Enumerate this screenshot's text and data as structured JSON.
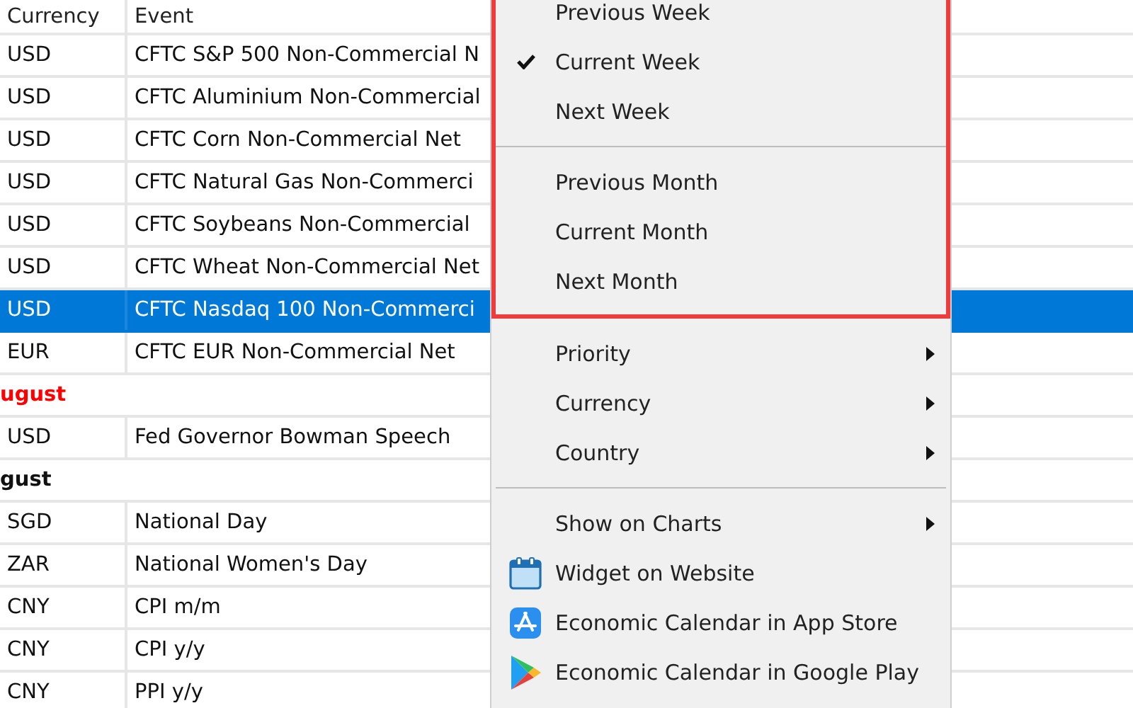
{
  "table": {
    "columns": [
      "Currency",
      "Event"
    ],
    "rows": [
      {
        "kind": "event",
        "currency": "USD",
        "event": "CFTC S&P 500 Non-Commercial N",
        "selected": false
      },
      {
        "kind": "event",
        "currency": "USD",
        "event": "CFTC Aluminium Non-Commercial",
        "selected": false
      },
      {
        "kind": "event",
        "currency": "USD",
        "event": "CFTC Corn Non-Commercial Net",
        "selected": false
      },
      {
        "kind": "event",
        "currency": "USD",
        "event": "CFTC Natural Gas Non-Commerci",
        "selected": false
      },
      {
        "kind": "event",
        "currency": "USD",
        "event": "CFTC Soybeans Non-Commercial",
        "selected": false
      },
      {
        "kind": "event",
        "currency": "USD",
        "event": "CFTC Wheat Non-Commercial Net",
        "selected": false
      },
      {
        "kind": "event",
        "currency": "USD",
        "event": "CFTC Nasdaq 100 Non-Commerci",
        "selected": true
      },
      {
        "kind": "event",
        "currency": "EUR",
        "event": "CFTC EUR Non-Commercial Net",
        "selected": false
      },
      {
        "kind": "group",
        "label": "ugust",
        "today": true
      },
      {
        "kind": "event",
        "currency": "USD",
        "event": "Fed Governor Bowman Speech",
        "selected": false
      },
      {
        "kind": "group",
        "label": "gust",
        "today": false
      },
      {
        "kind": "event",
        "currency": "SGD",
        "event": "National Day",
        "selected": false
      },
      {
        "kind": "event",
        "currency": "ZAR",
        "event": "National Women's Day",
        "selected": false
      },
      {
        "kind": "event",
        "currency": "CNY",
        "event": "CPI m/m",
        "selected": false
      },
      {
        "kind": "event",
        "currency": "CNY",
        "event": "CPI y/y",
        "selected": false
      },
      {
        "kind": "event",
        "currency": "CNY",
        "event": "PPI y/y",
        "selected": false
      }
    ]
  },
  "context_menu": {
    "blocks": [
      {
        "highlighted": true,
        "sections": [
          {
            "items": [
              {
                "kind": "check",
                "label": "Previous Week",
                "checked": false
              },
              {
                "kind": "check",
                "label": "Current Week",
                "checked": true
              },
              {
                "kind": "check",
                "label": "Next Week",
                "checked": false
              }
            ]
          },
          {
            "items": [
              {
                "kind": "check",
                "label": "Previous Month",
                "checked": false
              },
              {
                "kind": "check",
                "label": "Current Month",
                "checked": false
              },
              {
                "kind": "check",
                "label": "Next Month",
                "checked": false
              }
            ]
          }
        ]
      },
      {
        "highlighted": false,
        "sections": [
          {
            "items": [
              {
                "kind": "submenu",
                "label": "Priority"
              },
              {
                "kind": "submenu",
                "label": "Currency"
              },
              {
                "kind": "submenu",
                "label": "Country"
              }
            ]
          },
          {
            "items": [
              {
                "kind": "submenu",
                "label": "Show on Charts"
              },
              {
                "kind": "link",
                "label": "Widget on Website"
              },
              {
                "kind": "link",
                "label": "Economic Calendar in App Store"
              },
              {
                "kind": "link",
                "label": "Economic Calendar in Google Play"
              }
            ]
          }
        ]
      }
    ]
  }
}
